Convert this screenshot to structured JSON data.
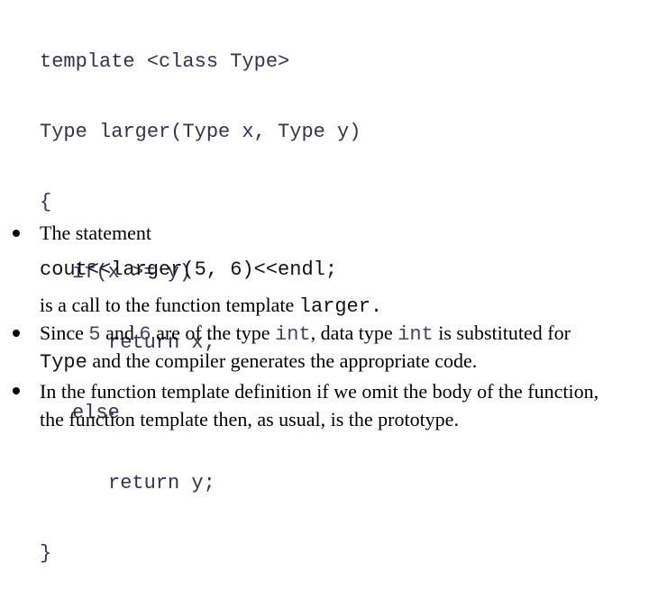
{
  "code_block": {
    "lines": [
      "template <class Type>",
      "Type larger(Type x, Type y)",
      "{",
      "if(x >= y)",
      "return x;",
      "else",
      "return y;",
      "}"
    ]
  },
  "bullets": [
    {
      "lead": "The statement",
      "code": "cout<<larger(5, 6)<<endl;",
      "follow_text": "is a call to the function template ",
      "follow_code": "larger."
    },
    {
      "t1": "Since ",
      "c1": "5",
      "t2": " and ",
      "c2": "6",
      "t3": " are of the type ",
      "c3": "int",
      "t4": ", data type ",
      "c4": "int",
      "t5": " is substituted for ",
      "c5": "Type",
      "t6": " and the compiler generates the appropriate code."
    },
    {
      "text": "In the function template definition if we omit the body of the function, the function template then, as usual, is the prototype."
    }
  ],
  "icons": {
    "bullet": "filled-circle-bullet"
  }
}
